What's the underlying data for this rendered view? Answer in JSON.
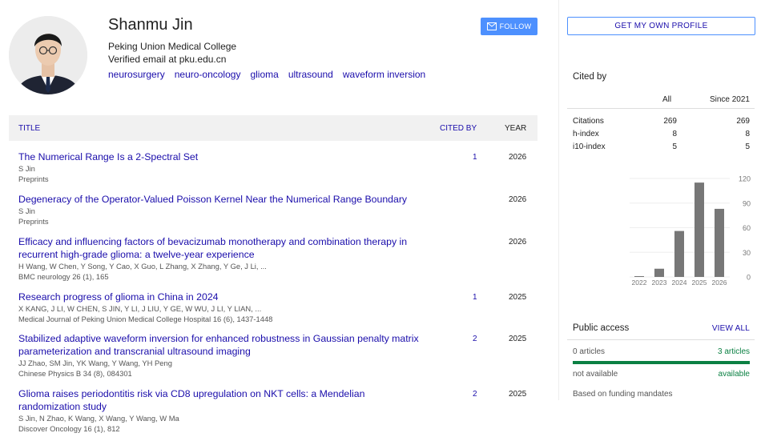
{
  "profile": {
    "name": "Shanmu Jin",
    "affiliation": "Peking Union Medical College",
    "email": "Verified email at pku.edu.cn",
    "interests": [
      "neurosurgery",
      "neuro-oncology",
      "glioma",
      "ultrasound",
      "waveform inversion"
    ],
    "follow_label": "FOLLOW",
    "own_profile_label": "GET MY OWN PROFILE"
  },
  "table": {
    "headers": {
      "title": "TITLE",
      "cited_by": "CITED BY",
      "year": "YEAR"
    },
    "rows": [
      {
        "title": "The Numerical Range Is a 2-Spectral Set",
        "authors": "S Jin",
        "venue": "Preprints",
        "cited": "1",
        "year": "2026"
      },
      {
        "title": "Degeneracy of the Operator-Valued Poisson Kernel Near the Numerical Range Boundary",
        "authors": "S Jin",
        "venue": "Preprints",
        "cited": "",
        "year": "2026"
      },
      {
        "title": "Efficacy and influencing factors of bevacizumab monotherapy and combination therapy in recurrent high-grade glioma: a twelve-year experience",
        "authors": "H Wang, W Chen, Y Song, Y Cao, X Guo, L Zhang, X Zhang, Y Ge, J Li, ...",
        "venue": "BMC neurology 26 (1), 165",
        "cited": "",
        "year": "2026"
      },
      {
        "title": "Research progress of glioma in China in 2024",
        "authors": "X KANG, J LI, W CHEN, S JIN, Y LI, J LIU, Y GE, W WU, J LI, Y LIAN, ...",
        "venue": "Medical Journal of Peking Union Medical College Hospital 16 (6), 1437-1448",
        "cited": "1",
        "year": "2025"
      },
      {
        "title": "Stabilized adaptive waveform inversion for enhanced robustness in Gaussian penalty matrix parameterization and transcranial ultrasound imaging",
        "authors": "JJ Zhao, SM Jin, YK Wang, Y Wang, YH Peng",
        "venue": "Chinese Physics B 34 (8), 084301",
        "cited": "2",
        "year": "2025"
      },
      {
        "title": "Glioma raises periodontitis risk via CD8 upregulation on NKT cells: a Mendelian randomization study",
        "authors": "S Jin, N Zhao, K Wang, X Wang, Y Wang, W Ma",
        "venue": "Discover Oncology 16 (1), 812",
        "cited": "2",
        "year": "2025"
      }
    ]
  },
  "cited_by": {
    "title": "Cited by",
    "col_all": "All",
    "col_since": "Since 2021",
    "rows": [
      {
        "label": "Citations",
        "all": "269",
        "since": "269"
      },
      {
        "label": "h-index",
        "all": "8",
        "since": "8"
      },
      {
        "label": "i10-index",
        "all": "5",
        "since": "5"
      }
    ]
  },
  "chart_data": {
    "type": "bar",
    "categories": [
      "2022",
      "2023",
      "2024",
      "2025",
      "2026"
    ],
    "values": [
      1,
      10,
      56,
      115,
      83
    ],
    "ylim": [
      0,
      120
    ],
    "yticks": [
      "120",
      "90",
      "60",
      "30",
      "0"
    ],
    "grid": true,
    "bar_color": "#777777"
  },
  "public_access": {
    "title": "Public access",
    "view_all": "VIEW ALL",
    "left_count": "0 articles",
    "right_count": "3 articles",
    "left_status": "not available",
    "right_status": "available",
    "footer": "Based on funding mandates",
    "available_fraction": 1.0
  },
  "colors": {
    "link": "#1a0dab",
    "button": "#4d90fe",
    "available": "#0b8043"
  }
}
